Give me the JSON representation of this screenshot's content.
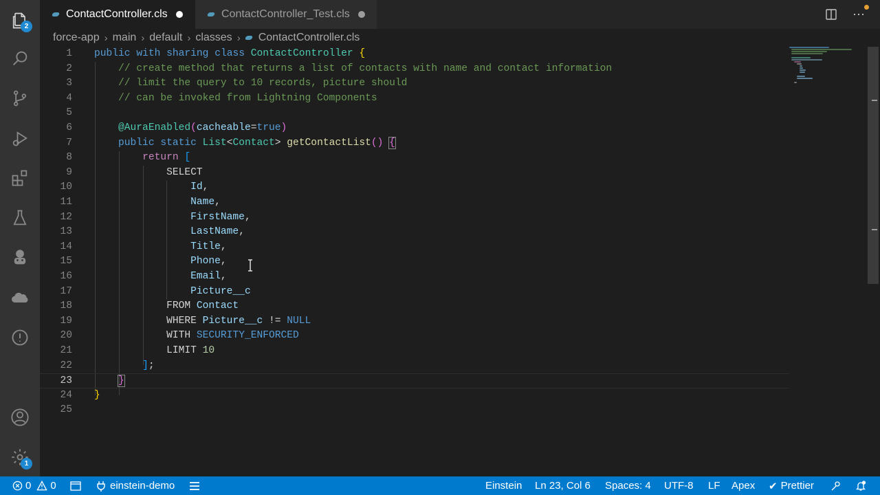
{
  "tabs": [
    {
      "label": "ContactController.cls",
      "active": true
    },
    {
      "label": "ContactController_Test.cls",
      "active": false
    }
  ],
  "breadcrumb": [
    "force-app",
    "main",
    "default",
    "classes",
    "ContactController.cls"
  ],
  "activity": {
    "explorer_badge": "2",
    "accounts_badge": "1",
    "icons": [
      "files-icon",
      "search-icon",
      "source-control-icon",
      "run-debug-icon",
      "extensions-icon",
      "testing-icon",
      "org-browser-icon",
      "salesforce-cloud-icon",
      "problems-icon",
      "account-icon",
      "settings-gear-icon"
    ]
  },
  "editor": {
    "current_line": 23,
    "line_numbers": [
      "1",
      "2",
      "3",
      "4",
      "5",
      "6",
      "7",
      "8",
      "9",
      "10",
      "11",
      "12",
      "13",
      "14",
      "15",
      "16",
      "17",
      "18",
      "19",
      "20",
      "21",
      "22",
      "23",
      "24",
      "25"
    ]
  },
  "status": {
    "errors": "0",
    "warnings": "0",
    "org": "einstein-demo",
    "einstein": "Einstein",
    "position": "Ln 23, Col 6",
    "spaces": "Spaces: 4",
    "encoding": "UTF-8",
    "eol": "LF",
    "language": "Apex",
    "prettier": "Prettier"
  },
  "colors": {
    "status_bar": "#007acc",
    "activity_bar": "#333333",
    "editor_bg": "#1e1e1e",
    "badge": "#1f8ad2"
  }
}
